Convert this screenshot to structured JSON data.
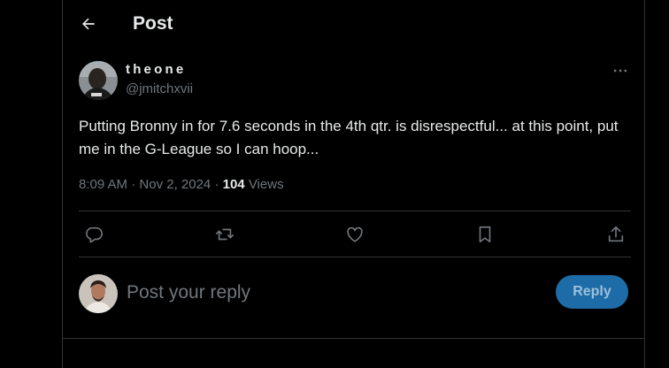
{
  "header": {
    "title": "Post",
    "back_icon": "arrow-left-icon"
  },
  "post": {
    "author": {
      "display_name": "theone",
      "handle": "@jmitchxvii",
      "avatar": "avatar-photo"
    },
    "more_icon": "more-horizontal-icon",
    "text": "Putting Bronny in for 7.6 seconds in the 4th qtr. is disrespectful... at this point, put me in the G-League so I can hoop...",
    "time": "8:09 AM",
    "separator": "·",
    "date": "Nov 2, 2024",
    "views_count": "104",
    "views_label": "Views"
  },
  "actions": [
    {
      "name": "reply",
      "icon": "reply-icon"
    },
    {
      "name": "repost",
      "icon": "repost-icon"
    },
    {
      "name": "like",
      "icon": "heart-icon"
    },
    {
      "name": "bookmark",
      "icon": "bookmark-icon"
    },
    {
      "name": "share",
      "icon": "share-icon"
    }
  ],
  "composer": {
    "placeholder": "Post your reply",
    "value": "",
    "reply_label": "Reply"
  },
  "colors": {
    "background": "#000000",
    "text": "#e7e9ea",
    "muted": "#71767b",
    "divider": "#2f3336",
    "reply_button": "#1d6ca7"
  }
}
